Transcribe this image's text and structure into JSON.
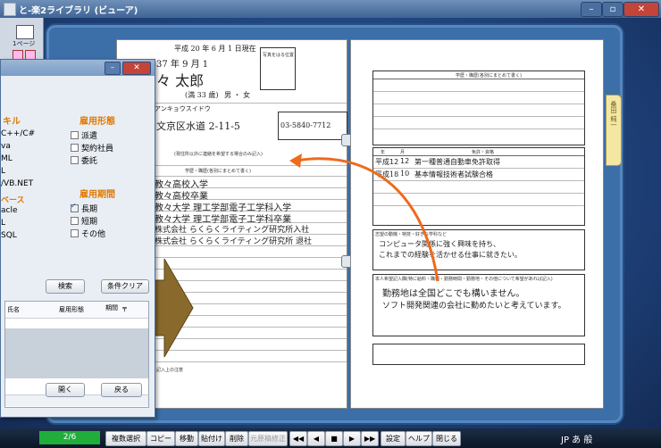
{
  "window": {
    "title": "と-楽2ライブラリ (ビューア)",
    "min": "–",
    "max": "▫",
    "close": "✕"
  },
  "lefttool": {
    "label": "1ページ"
  },
  "panel": {
    "skills_heading": "キル",
    "skills": [
      "C++/C#",
      "va",
      "ML",
      "L",
      "/VB.NET",
      "ベース",
      "acle",
      "L",
      "SQL"
    ],
    "employment_heading": "雇用形態",
    "employment": [
      {
        "label": "派遣",
        "checked": false
      },
      {
        "label": "契約社員",
        "checked": false
      },
      {
        "label": "委託",
        "checked": false
      }
    ],
    "period_heading": "雇用期間",
    "period": [
      {
        "label": "長期",
        "checked": true
      },
      {
        "label": "短期",
        "checked": false
      },
      {
        "label": "その他",
        "checked": false
      }
    ],
    "search_button": "検索",
    "clear_button": "条件クリア",
    "columns": [
      "氏名",
      "雇用形態",
      "期間",
      "〒"
    ],
    "open_button": "開く",
    "back_button": "戻る"
  },
  "resume": {
    "date": "平成 20 年 6 月 1 日現在",
    "birth": "37 年 9 月 1",
    "name": "々 太郎",
    "age": "(満 33 歳)",
    "sex": "男 ・ 女",
    "furigana": "アンキョウスイドウ",
    "address": "文京区水道 2-11-5",
    "phone": "03-5840-7712",
    "photo_note": "写真をはる位置",
    "contact_note": "(現住所以外に連絡を希望する場合のみ記入)",
    "history_header": "学歴・職歴(各別にまとめて書く)",
    "history": [
      "教々高校入学",
      "教々高校卒業",
      "教々大学 理工学部電子工学科入学",
      "教々大学 理工学部電子工学科卒業",
      "株式会社 らくらくライティング研究所入社",
      "株式会社 らくらくライティング研究所 退社"
    ],
    "footer_note": "記入上の注意"
  },
  "resume_right": {
    "header1": "学歴・職歴(各別にまとめて書く)",
    "col_year": "年",
    "col_month": "月",
    "header2": "免許・資格",
    "licenses": [
      {
        "year": "平成12",
        "month": "12",
        "text": "第一種普通自動車免許取得"
      },
      {
        "year": "平成18",
        "month": "10",
        "text": "基本情報技術者試験合格"
      }
    ],
    "motivation_label": "志望の動機・特技・好きな学科など",
    "motivation": [
      "コンピュータ関係に強く興味を持ち、",
      "これまでの経験を活かせる仕事に就きたい。"
    ],
    "hope_label": "本人希望記入欄(特に給料・職種・勤務時間・勤務地・その他について希望があれば記入)",
    "hope": [
      "勤務地は全国どこでも構いません。",
      "ソフト開発関連の会社に勤めたいと考えています。"
    ]
  },
  "bottombar": {
    "page": "2/6",
    "buttons": [
      "複数選択",
      "コピー",
      "移動",
      "貼付け",
      "削除",
      "元原稿修正"
    ],
    "nav": [
      "◀◀",
      "◀",
      "■",
      "▶",
      "▶▶"
    ],
    "right_buttons": [
      "設定",
      "ヘルプ",
      "閉じる"
    ],
    "tray": "JP あ 般"
  },
  "colors": {
    "accent": "#e07a00",
    "binder": "#3c6ea8",
    "page_ind": "#1fae3a"
  }
}
